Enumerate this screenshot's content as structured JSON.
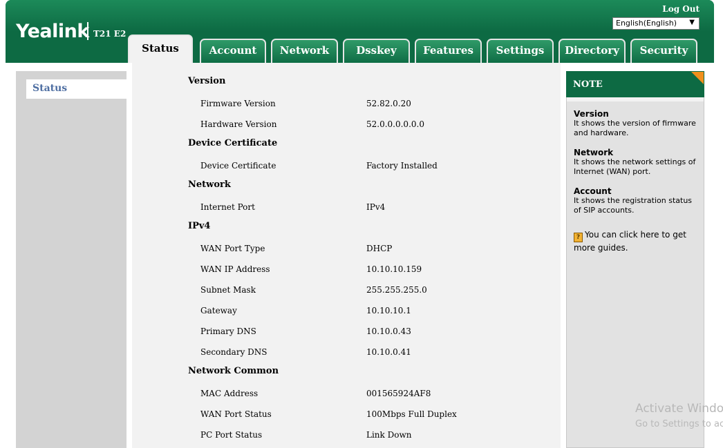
{
  "header": {
    "logo": "Yealink",
    "model": "T21 E2",
    "logout": "Log Out",
    "language": "English(English)"
  },
  "tabs": [
    {
      "label": "Status",
      "active": true
    },
    {
      "label": "Account"
    },
    {
      "label": "Network"
    },
    {
      "label": "Dsskey"
    },
    {
      "label": "Features"
    },
    {
      "label": "Settings"
    },
    {
      "label": "Directory"
    },
    {
      "label": "Security"
    }
  ],
  "sidebar": {
    "items": [
      {
        "label": "Status"
      }
    ]
  },
  "main": {
    "sections": [
      {
        "title": "Version",
        "rows": [
          {
            "label": "Firmware Version",
            "value": "52.82.0.20"
          },
          {
            "label": "Hardware Version",
            "value": "52.0.0.0.0.0.0"
          }
        ]
      },
      {
        "title": "Device Certificate",
        "rows": [
          {
            "label": "Device Certificate",
            "value": "Factory Installed"
          }
        ]
      },
      {
        "title": "Network",
        "rows": [
          {
            "label": "Internet Port",
            "value": "IPv4"
          }
        ]
      },
      {
        "title": "IPv4",
        "rows": [
          {
            "label": "WAN Port Type",
            "value": "DHCP"
          },
          {
            "label": "WAN IP Address",
            "value": "10.10.10.159"
          },
          {
            "label": "Subnet Mask",
            "value": "255.255.255.0"
          },
          {
            "label": "Gateway",
            "value": "10.10.10.1"
          },
          {
            "label": "Primary DNS",
            "value": "10.10.0.43"
          },
          {
            "label": "Secondary DNS",
            "value": "10.10.0.41"
          }
        ]
      },
      {
        "title": "Network Common",
        "rows": [
          {
            "label": "MAC Address",
            "value": "001565924AF8"
          },
          {
            "label": "WAN Port Status",
            "value": "100Mbps Full Duplex"
          },
          {
            "label": "PC Port Status",
            "value": "Link Down"
          }
        ]
      }
    ]
  },
  "note": {
    "title": "NOTE",
    "blocks": [
      {
        "heading": "Version",
        "text": "It shows the version of firmware and hardware."
      },
      {
        "heading": "Network",
        "text": "It shows the network settings of Internet (WAN) port."
      },
      {
        "heading": "Account",
        "text": "It shows the registration status of SIP accounts."
      }
    ],
    "guide": "You can click here to get more guides."
  },
  "watermark": {
    "line1": "Activate Windo",
    "line2": "Go to Settings to ac"
  },
  "colors": {
    "brand_green": "#0d6a43",
    "note_corner": "#f08f1c",
    "sidebar_link": "#4f6fa2"
  }
}
